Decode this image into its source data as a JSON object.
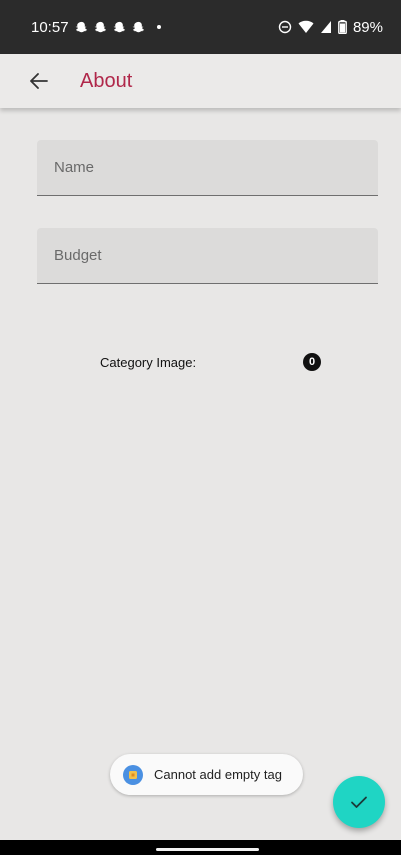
{
  "status_bar": {
    "time": "10:57",
    "battery": "89%",
    "notification_icons": [
      "snapchat-icon",
      "snapchat-icon",
      "snapchat-icon",
      "snapchat-icon"
    ]
  },
  "app_bar": {
    "title": "About",
    "title_color": "#b0274a"
  },
  "form": {
    "name_placeholder": "Name",
    "budget_placeholder": "Budget",
    "category_label": "Category Image:",
    "category_value": "0"
  },
  "toast": {
    "message": "Cannot add empty tag"
  },
  "fab": {
    "icon": "check-icon",
    "color": "#1fd5c4"
  }
}
